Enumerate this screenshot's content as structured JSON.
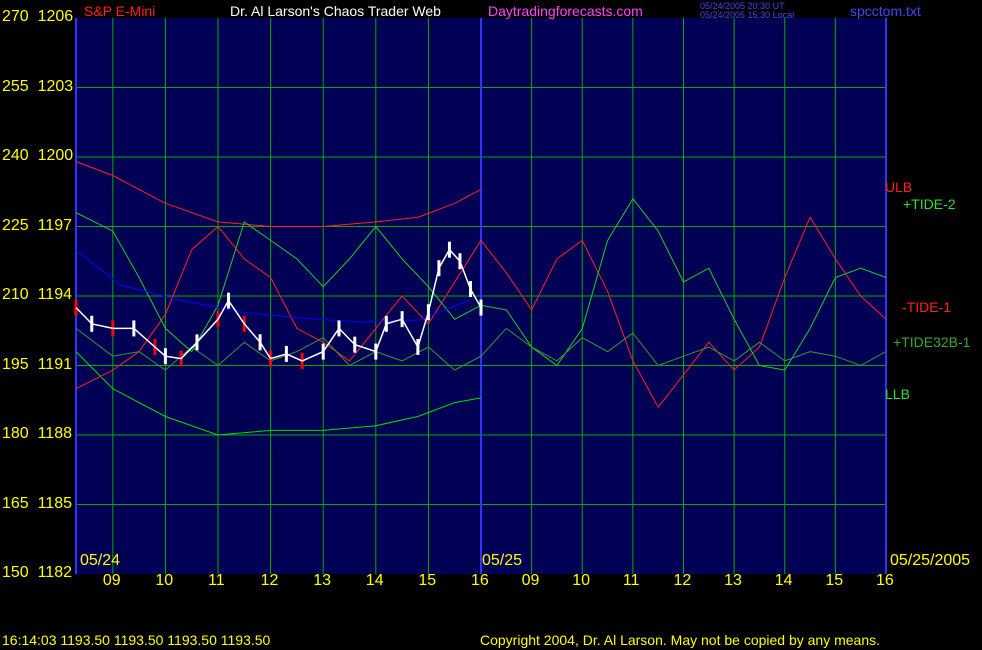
{
  "header": {
    "instrument": "S&P E-Mini",
    "site_title": "Dr. Al Larson's Chaos Trader Web",
    "site_url": "Daytradingforecasts.com",
    "timestamp_ut": "05/24/2005 20:30 UT",
    "timestamp_local": "05/24/2005 15:30 Local",
    "filename": "spcctom.txt"
  },
  "footer": {
    "status": "16:14:03  1193.50 1193.50 1193.50 1193.50",
    "copyright": "Copyright 2004, Dr. Al Larson. May not be copied by any means."
  },
  "colors": {
    "background": "#000055",
    "grid": "#00aa00",
    "price_white": "#ffffff",
    "price_red": "#ff0000",
    "ulb_llb": "#00dd00",
    "tide_red": "#ff2020",
    "tide_green": "#22cc22",
    "tide32b": "#339933",
    "blue_line": "#0000ff",
    "divider": "#3333ff",
    "label_yellow": "#ffff00"
  },
  "chart_data": {
    "type": "line",
    "title": "S&P E-Mini",
    "y_left_ticks": [
      "270",
      "255",
      "240",
      "225",
      "210",
      "195",
      "180",
      "165",
      "150"
    ],
    "y_price_ticks": [
      "1206",
      "1203",
      "1200",
      "1197",
      "1194",
      "1191",
      "1188",
      "1185",
      "1182"
    ],
    "ylim_price": [
      1182,
      1206
    ],
    "ylim_index": [
      150,
      270
    ],
    "x_hours": [
      "09",
      "10",
      "11",
      "12",
      "13",
      "14",
      "15",
      "16",
      "09",
      "10",
      "11",
      "12",
      "13",
      "14",
      "15",
      "16"
    ],
    "x_dates": [
      "05/24",
      "05/25",
      "05/25/2005"
    ],
    "annotations": [
      "ULB",
      "+TIDE-2",
      "-TIDE-1",
      "+TIDE32B-1",
      "LLB"
    ],
    "series": [
      {
        "name": "ULB",
        "x": [
          8.3,
          9,
          10,
          11,
          12,
          13,
          14,
          14.8,
          15.5,
          16
        ],
        "values": [
          239,
          236,
          230,
          226,
          225,
          225,
          226,
          227,
          230,
          233
        ]
      },
      {
        "name": "LLB",
        "x": [
          8.3,
          9,
          10,
          11,
          12,
          13,
          14,
          14.8,
          15.5,
          16
        ],
        "values": [
          198,
          190,
          184,
          180,
          181,
          181,
          182,
          184,
          187,
          188
        ]
      },
      {
        "name": "-TIDE-1",
        "x": [
          8.3,
          9,
          9.5,
          10,
          10.5,
          11,
          11.5,
          12,
          12.5,
          13,
          13.5,
          14,
          14.5,
          15,
          15.5,
          16,
          16.5,
          17,
          17.5,
          18,
          18.5,
          19,
          19.5,
          20,
          20.5,
          21,
          21.5,
          22,
          22.5,
          23,
          23.5,
          24
        ],
        "values": [
          190,
          194,
          198,
          206,
          220,
          225,
          218,
          214,
          203,
          200,
          196,
          203,
          210,
          204,
          213,
          222,
          215,
          207,
          218,
          222,
          211,
          196,
          186,
          193,
          200,
          194,
          199,
          214,
          227,
          218,
          210,
          205
        ]
      },
      {
        "name": "+TIDE-2",
        "x": [
          8.3,
          9,
          9.5,
          10,
          10.5,
          11,
          11.5,
          12,
          12.5,
          13,
          13.5,
          14,
          14.5,
          15,
          15.5,
          16,
          16.5,
          17,
          17.5,
          18,
          18.5,
          19,
          19.5,
          20,
          20.5,
          21,
          21.5,
          22,
          22.5,
          23,
          23.5,
          24
        ],
        "values": [
          228,
          224,
          214,
          203,
          198,
          208,
          226,
          222,
          218,
          212,
          218,
          225,
          218,
          212,
          205,
          208,
          207,
          199,
          195,
          203,
          222,
          231,
          224,
          213,
          216,
          205,
          195,
          194,
          203,
          214,
          216,
          214
        ]
      },
      {
        "name": "+TIDE32B-1",
        "x": [
          8.3,
          9,
          9.5,
          10,
          10.5,
          11,
          11.5,
          12,
          12.5,
          13,
          13.5,
          14,
          14.5,
          15,
          15.5,
          16,
          16.5,
          17,
          17.5,
          18,
          18.5,
          19,
          19.5,
          20,
          20.5,
          21,
          21.5,
          22,
          22.5,
          23,
          23.5,
          24
        ],
        "values": [
          203,
          197,
          198,
          194,
          199,
          195,
          200,
          196,
          198,
          201,
          195,
          198,
          196,
          199,
          194,
          197,
          203,
          199,
          196,
          201,
          198,
          202,
          195,
          197,
          199,
          196,
          200,
          196,
          198,
          197,
          195,
          198
        ]
      },
      {
        "name": "S&P E-Mini",
        "x": [
          8.3,
          8.6,
          9,
          9.4,
          9.8,
          10,
          10.3,
          10.6,
          11,
          11.2,
          11.5,
          11.8,
          12,
          12.3,
          12.6,
          13,
          13.3,
          13.6,
          14,
          14.2,
          14.5,
          14.8,
          15,
          15.2,
          15.4,
          15.6,
          15.8,
          16
        ],
        "values": [
          1193.5,
          1192.8,
          1192.6,
          1192.6,
          1191.8,
          1191.4,
          1191.3,
          1192.0,
          1193.0,
          1193.8,
          1192.8,
          1192.0,
          1191.3,
          1191.5,
          1191.2,
          1191.6,
          1192.6,
          1191.9,
          1191.6,
          1192.8,
          1193.0,
          1191.8,
          1193.3,
          1195.2,
          1196.0,
          1195.5,
          1194.3,
          1193.5
        ]
      }
    ]
  }
}
